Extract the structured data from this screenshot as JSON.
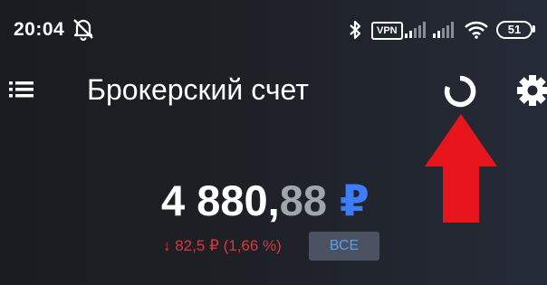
{
  "status_bar": {
    "time": "20:04",
    "vpn_label": "VPN",
    "battery_level": "51",
    "icons": [
      "bell-off-icon",
      "bluetooth-icon",
      "signal-icon",
      "wifi-icon",
      "battery-icon"
    ]
  },
  "header": {
    "title": "Брокерский счет",
    "icons": [
      "menu-icon",
      "refresh-icon",
      "gear-icon"
    ]
  },
  "annotation": {
    "arrow_color": "#e8141c",
    "icon": "arrow-up-icon"
  },
  "balance": {
    "integer_part": "4 880,",
    "fraction_part": "88",
    "currency": "₽"
  },
  "change": {
    "text": "↓ 82,5 ₽ (1,66 %)",
    "color": "#d9373f"
  },
  "period_button": {
    "label": "ВСЕ"
  },
  "colors": {
    "accent": "#3d7dfa",
    "negative": "#d9373f",
    "muted": "#a1a6ad"
  }
}
